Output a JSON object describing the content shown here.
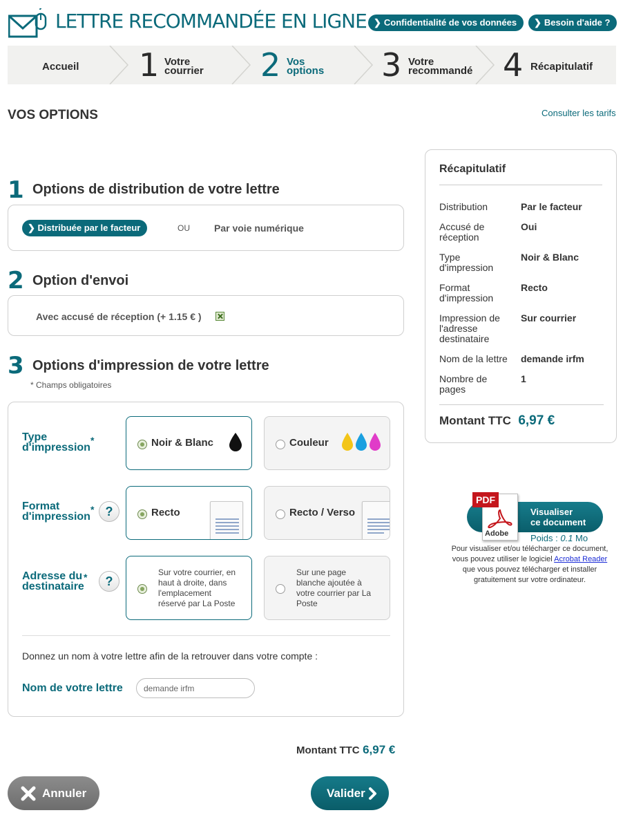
{
  "header": {
    "title": "LETTRE RECOMMANDÉE EN LIGNE",
    "links": [
      "Confidentialité de vos données",
      "Besoin d'aide ?"
    ]
  },
  "steps": {
    "home": "Accueil",
    "items": [
      {
        "num": "1",
        "line1": "Votre",
        "line2": "courrier"
      },
      {
        "num": "2",
        "line1": "Vos",
        "line2": "options"
      },
      {
        "num": "3",
        "line1": "Votre",
        "line2": "recommandé"
      },
      {
        "num": "4",
        "line1": "Récapitulatif",
        "line2": ""
      }
    ],
    "active_step": "2"
  },
  "page": {
    "title": "VOS OPTIONS",
    "tarifs_link": "Consulter les tarifs"
  },
  "section1": {
    "num": "1",
    "title": "Options de distribution de votre lettre",
    "option_selected": "Distribuée par le facteur",
    "or": "OU",
    "option_other": "Par voie numérique"
  },
  "section2": {
    "num": "2",
    "title": "Option d'envoi",
    "accuse_label": "Avec accusé de réception (+ 1.15 € )",
    "accuse_checked": true
  },
  "section3": {
    "num": "3",
    "title": "Options d'impression de votre lettre",
    "required_note": "* Champs obligatoires",
    "star": "*",
    "type": {
      "label_l1": "Type",
      "label_l2": "d'impression",
      "opt1": "Noir & Blanc",
      "opt2": "Couleur",
      "ink_colors": [
        "#f3c518",
        "#1aa0e0",
        "#e03cc8"
      ]
    },
    "format": {
      "label_l1": "Format",
      "label_l2": "d'impression",
      "opt1": "Recto",
      "opt2": "Recto / Verso"
    },
    "adresse": {
      "label_l1": "Adresse du",
      "label_l2": "destinataire",
      "opt1_l1": "Sur votre courrier, en",
      "opt1_l2": "haut à droite, dans",
      "opt1_l3": "l'emplacement",
      "opt1_l4": "réservé par La Poste",
      "opt2_l1": "Sur une page",
      "opt2_l2": "blanche ajoutée à",
      "opt2_l3": "votre courrier par La",
      "opt2_l4": "Poste"
    },
    "help_mark": "?",
    "name_prompt": "Donnez un nom à votre lettre afin de la retrouver dans votre compte :",
    "name_label": "Nom de votre lettre",
    "name_value": "demande irfm"
  },
  "total": {
    "label": "Montant TTC",
    "amount": "6,97 €"
  },
  "buttons": {
    "cancel": "Annuler",
    "validate": "Valider"
  },
  "summary": {
    "title": "Récapitulatif",
    "rows": [
      {
        "k1": "Distribution",
        "k2": "",
        "k3": "",
        "v": "Par le facteur"
      },
      {
        "k1": "Accusé de",
        "k2": "réception",
        "k3": "",
        "v": "Oui"
      },
      {
        "k1": "Type",
        "k2": "d'impression",
        "k3": "",
        "v": "Noir & Blanc"
      },
      {
        "k1": "Format",
        "k2": "d'impression",
        "k3": "",
        "v": "Recto"
      },
      {
        "k1": "Impression de",
        "k2": "l'adresse",
        "k3": "destinataire",
        "v": "Sur courrier"
      },
      {
        "k1": "Nom de la lettre",
        "k2": "",
        "k3": "",
        "v": "demande irfm"
      },
      {
        "k1": "Nombre de",
        "k2": "pages",
        "k3": "",
        "v": "1"
      }
    ],
    "total_label": "Montant TTC",
    "total_amount": "6,97 €"
  },
  "pdf": {
    "badge": "PDF",
    "brand": "Adobe",
    "btn_l1": "Visualiser",
    "btn_l2": "ce document",
    "weight_prefix": "Poids : ",
    "weight_value": "0.1",
    "weight_unit": " Mo",
    "note_l1": "Pour visualiser et/ou télécharger ce document,",
    "note_l2a": "vous pouvez utiliser le logiciel ",
    "note_link": "Acrobat Reader",
    "note_l3": "que vous pouvez télécharger et installer",
    "note_l4": "gratuitement sur votre ordinateur."
  },
  "colors": {
    "teal": "#0b6a7a",
    "grey_button": "#7d7d7d"
  }
}
